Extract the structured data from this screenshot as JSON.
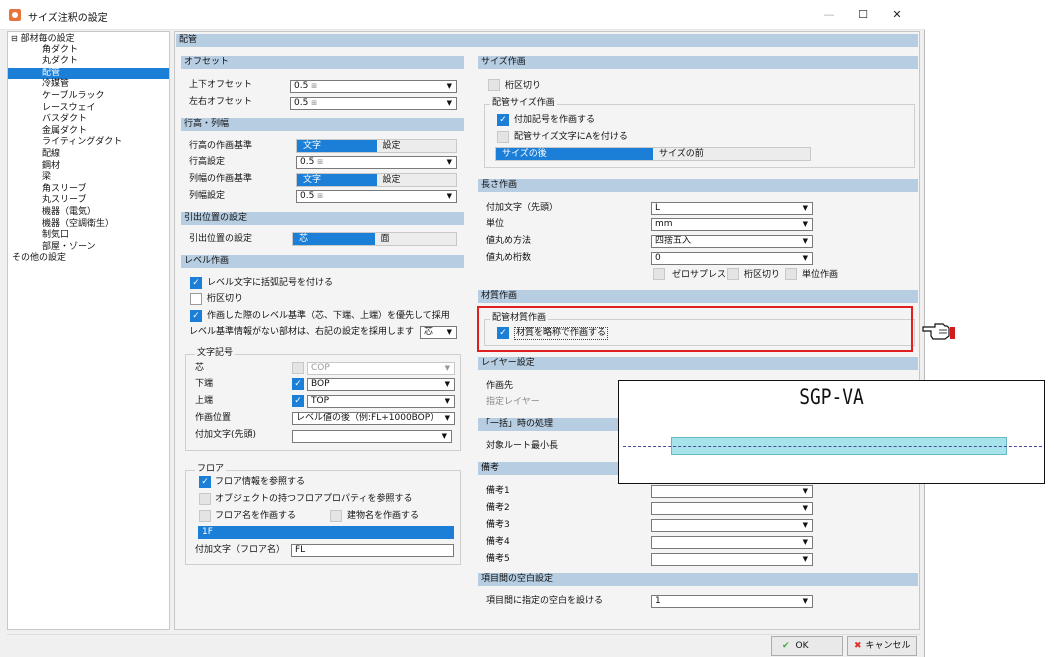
{
  "window": {
    "title": "サイズ注釈の設定",
    "minimize": "—",
    "maximize": "☐",
    "close": "✕",
    "accent": "#1b7fd8"
  },
  "tree": {
    "root": "部材毎の設定",
    "items": [
      "角ダクト",
      "丸ダクト",
      "配管",
      "冷媒管",
      "ケーブルラック",
      "レースウェイ",
      "バスダクト",
      "金属ダクト",
      "ライティングダクト",
      "配線",
      "鋼材",
      "梁",
      "角スリーブ",
      "丸スリーブ",
      "機器（電気）",
      "機器（空調衛生）",
      "制気口",
      "部屋・ゾーン"
    ],
    "selected": "配管",
    "other": "その他の設定"
  },
  "content": {
    "title": "配管",
    "offset": {
      "header": "オフセット",
      "updown_label": "上下オフセット",
      "updown_value": "0.5",
      "lr_label": "左右オフセット",
      "lr_value": "0.5",
      "unit_icon": "⊞"
    },
    "rowcol": {
      "header": "行高・列幅",
      "row_base_label": "行高の作画基準",
      "row_base_opts": [
        "文字",
        "設定"
      ],
      "row_set_label": "行高設定",
      "row_set_value": "0.5",
      "col_base_label": "列幅の作画基準",
      "col_base_opts": [
        "文字",
        "設定"
      ],
      "col_set_label": "列幅設定",
      "col_set_value": "0.5"
    },
    "leader": {
      "header": "引出位置の設定",
      "label": "引出位置の設定",
      "opts": [
        "芯",
        "面"
      ]
    },
    "level": {
      "header": "レベル作画",
      "cb1": "レベル文字に括弧記号を付ける",
      "cb2": "桁区切り",
      "cb3": "作画した際のレベル基準（芯、下端、上端）を優先して採用",
      "no_base_label": "レベル基準情報がない部材は、右記の設定を採用します",
      "no_base_value": "芯",
      "moji": {
        "title": "文字記号",
        "center_label": "芯",
        "center_value": "COP",
        "bottom_label": "下端",
        "bottom_value": "BOP",
        "top_label": "上端",
        "top_value": "TOP",
        "pos_label": "作画位置",
        "pos_value": "レベル値の後（例:FL+1000BOP）",
        "prefix_label": "付加文字(先頭)",
        "prefix_value": ""
      },
      "floor": {
        "title": "フロア",
        "cb1": "フロア情報を参照する",
        "cb2": "オブジェクトの持つフロアプロパティを参照する",
        "cb3": "フロア名を作画する",
        "cb4": "建物名を作画する",
        "floor_value": "1F",
        "prefix_label": "付加文字（フロア名）",
        "prefix_value": "FL"
      }
    },
    "size": {
      "header": "サイズ作画",
      "cb_digit": "桁区切り",
      "pipe_group_title": "配管サイズ作画",
      "cb_symbol": "付加記号を作画する",
      "cb_a": "配管サイズ文字にAを付ける",
      "pos_opts": [
        "サイズの後",
        "サイズの前"
      ]
    },
    "length": {
      "header": "長さ作画",
      "prefix_label": "付加文字（先頭）",
      "prefix_value": "L",
      "unit_label": "単位",
      "unit_value": "mm",
      "round_label": "値丸め方法",
      "round_value": "四捨五入",
      "digits_label": "値丸め桁数",
      "digits_value": "0",
      "cb_zero": "ゼロサプレス",
      "cb_digit": "桁区切り",
      "cb_unit": "単位作画"
    },
    "material": {
      "header": "材質作画",
      "group_title": "配管材質作画",
      "cb_abbr": "材質を略称で作画する"
    },
    "layer": {
      "header": "レイヤー設定",
      "target_label": "作画先",
      "layer_label": "指定レイヤー"
    },
    "batch": {
      "header": "「一括」時の処理",
      "min_len_label": "対象ルート最小長"
    },
    "notes": {
      "header": "備考",
      "labels": [
        "備考1",
        "備考2",
        "備考3",
        "備考4",
        "備考5"
      ]
    },
    "spacing": {
      "header": "項目間の空白設定",
      "label": "項目間に指定の空白を設ける",
      "value": "1"
    }
  },
  "preview": {
    "text": "SGP-VA"
  },
  "footer": {
    "ok": "OK",
    "cancel": "キャンセル"
  }
}
